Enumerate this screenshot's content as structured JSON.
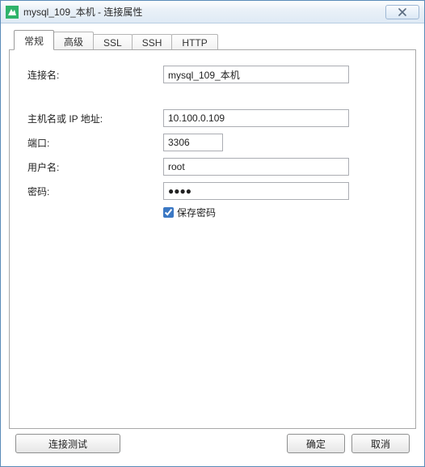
{
  "window": {
    "title": "mysql_109_本机 - 连接属性"
  },
  "tabs": {
    "general": "常规",
    "advanced": "高级",
    "ssl": "SSL",
    "ssh": "SSH",
    "http": "HTTP"
  },
  "labels": {
    "conn_name": "连接名:",
    "host": "主机名或 IP 地址:",
    "port": "端口:",
    "user": "用户名:",
    "password": "密码:",
    "save_pw": "保存密码"
  },
  "values": {
    "conn_name": "mysql_109_本机",
    "host": "10.100.0.109",
    "port": "3306",
    "user": "root",
    "password": "●●●●"
  },
  "buttons": {
    "test": "连接测试",
    "ok": "确定",
    "cancel": "取消"
  }
}
